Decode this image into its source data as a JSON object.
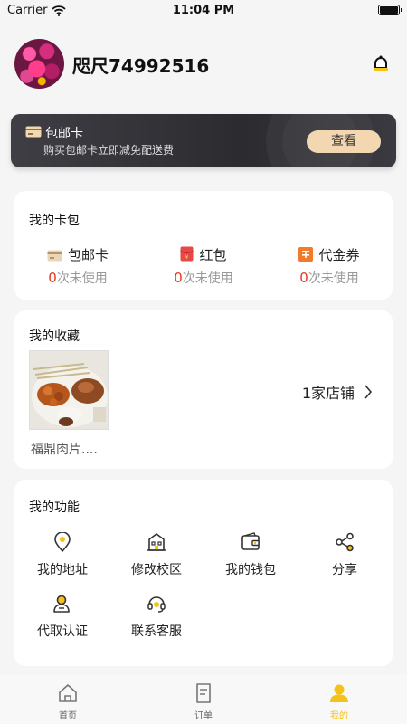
{
  "status_bar": {
    "carrier": "Carrier",
    "time": "11:04 PM"
  },
  "profile": {
    "username": "咫尺74992516"
  },
  "vip_card": {
    "title": "包邮卡",
    "subtitle": "购买包邮卡立即减免配送费",
    "button": "查看"
  },
  "wallet": {
    "title": "我的卡包",
    "items": [
      {
        "label": "包邮卡",
        "count": "0",
        "suffix": "次未使用",
        "icon": "card-icon"
      },
      {
        "label": "红包",
        "count": "0",
        "suffix": "次未使用",
        "icon": "red-packet-icon"
      },
      {
        "label": "代金券",
        "count": "0",
        "suffix": "次未使用",
        "icon": "voucher-icon"
      }
    ]
  },
  "favorites": {
    "title": "我的收藏",
    "item_name": "福鼎肉片....",
    "shop_count": "1家店铺"
  },
  "functions": {
    "title": "我的功能",
    "items": [
      {
        "label": "我的地址",
        "icon": "location-icon"
      },
      {
        "label": "修改校区",
        "icon": "building-icon"
      },
      {
        "label": "我的钱包",
        "icon": "wallet-icon"
      },
      {
        "label": "分享",
        "icon": "share-icon"
      },
      {
        "label": "代取认证",
        "icon": "user-check-icon"
      },
      {
        "label": "联系客服",
        "icon": "headset-icon"
      }
    ]
  },
  "tabbar": {
    "tabs": [
      {
        "label": "首页"
      },
      {
        "label": "订单"
      },
      {
        "label": "我的"
      }
    ],
    "active_color": "#f5c21b"
  },
  "colors": {
    "accent": "#f5c21b",
    "count_red": "#e6381f",
    "vip_button": "#f3d7b0"
  }
}
